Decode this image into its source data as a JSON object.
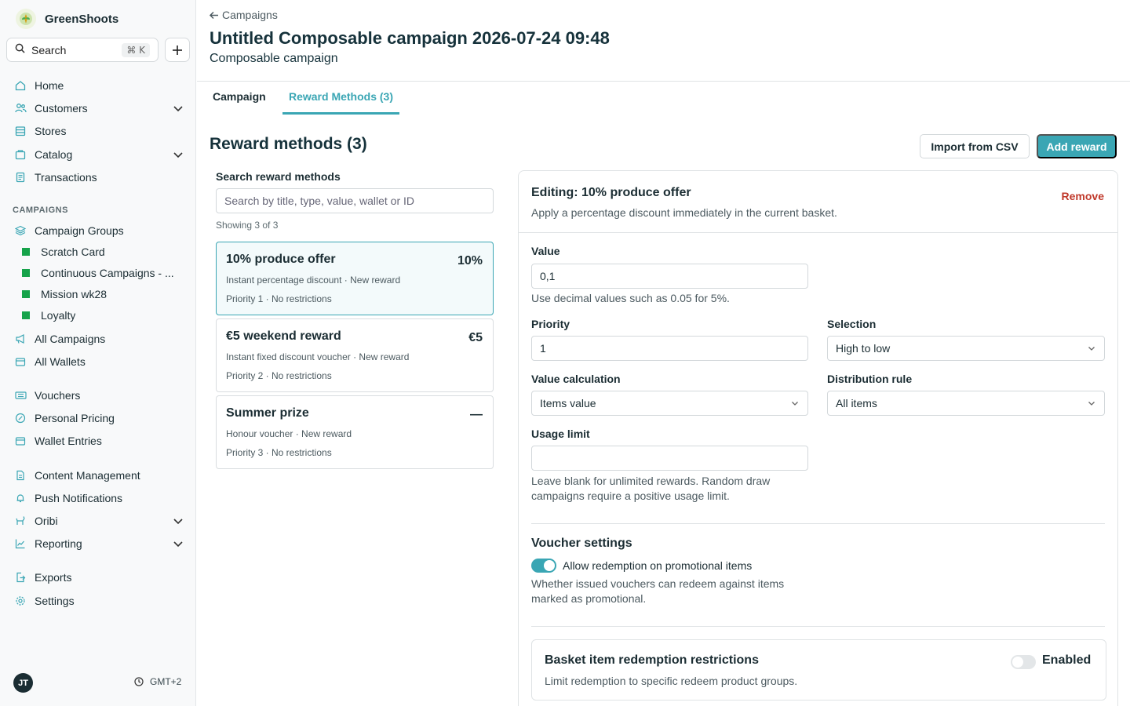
{
  "brand": {
    "name": "GreenShoots"
  },
  "sidebar": {
    "search_label": "Search",
    "search_shortcut": "⌘ K",
    "nav_main": [
      {
        "label": "Home",
        "icon": "home-icon"
      },
      {
        "label": "Customers",
        "icon": "users-icon",
        "expandable": true
      },
      {
        "label": "Stores",
        "icon": "store-icon"
      },
      {
        "label": "Catalog",
        "icon": "catalog-icon",
        "expandable": true
      },
      {
        "label": "Transactions",
        "icon": "receipt-icon"
      }
    ],
    "campaigns_heading": "CAMPAIGNS",
    "campaign_groups_label": "Campaign Groups",
    "campaign_groups": [
      {
        "label": "Scratch Card",
        "color": "#16a34a"
      },
      {
        "label": "Continuous Campaigns - ...",
        "color": "#16a34a"
      },
      {
        "label": "Mission wk28",
        "color": "#16a34a"
      },
      {
        "label": "Loyalty",
        "color": "#16a34a"
      }
    ],
    "all_campaigns": "All Campaigns",
    "all_wallets": "All Wallets",
    "vouchers": "Vouchers",
    "personal_pricing": "Personal Pricing",
    "wallet_entries": "Wallet Entries",
    "content_management": "Content Management",
    "push_notifications": "Push Notifications",
    "oribi": "Oribi",
    "reporting": "Reporting",
    "exports": "Exports",
    "settings": "Settings",
    "avatar_initials": "JT",
    "timezone": "GMT+2"
  },
  "header": {
    "back_label": "Campaigns",
    "title": "Untitled Composable campaign 2026-07-24 09:48",
    "subtitle": "Composable campaign",
    "tabs": [
      {
        "label": "Campaign",
        "active": false
      },
      {
        "label": "Reward Methods (3)",
        "active": true
      }
    ]
  },
  "rewards": {
    "heading": "Reward methods (3)",
    "import_label": "Import from CSV",
    "add_label": "Add reward",
    "search_label": "Search reward methods",
    "search_placeholder": "Search by title, type, value, wallet or ID",
    "showing": "Showing 3 of 3",
    "items": [
      {
        "title": "10% produce offer",
        "value": "10%",
        "desc": "Instant percentage discount · New reward",
        "meta": "Priority 1  ·  No restrictions",
        "selected": true
      },
      {
        "title": "€5 weekend reward",
        "value": "€5",
        "desc": "Instant fixed discount voucher · New reward",
        "meta": "Priority 2  ·  No restrictions",
        "selected": false
      },
      {
        "title": "Summer prize",
        "value": "—",
        "desc": "Honour voucher · New reward",
        "meta": "Priority 3  ·  No restrictions",
        "selected": false
      }
    ]
  },
  "editor": {
    "title": "Editing: 10% produce offer",
    "description": "Apply a percentage discount immediately in the current basket.",
    "remove_label": "Remove",
    "value_label": "Value",
    "value": "0,1",
    "value_help": "Use decimal values such as 0.05 for 5%.",
    "priority_label": "Priority",
    "priority": "1",
    "selection_label": "Selection",
    "selection": "High to low",
    "value_calc_label": "Value calculation",
    "value_calc": "Items value",
    "distribution_label": "Distribution rule",
    "distribution": "All items",
    "usage_label": "Usage limit",
    "usage_value": "",
    "usage_help_1": "Leave blank for unlimited rewards. Random draw",
    "usage_help_2": "campaigns require a positive usage limit.",
    "voucher_heading": "Voucher settings",
    "promo_toggle_label": "Allow redemption on promotional items",
    "promo_toggle_on": true,
    "promo_help_1": "Whether issued vouchers can redeem against items",
    "promo_help_2": "marked as promotional.",
    "basket_title": "Basket item redemption restrictions",
    "basket_desc": "Limit redemption to specific redeem product groups.",
    "basket_toggle_label": "Enabled",
    "basket_toggle_on": false
  },
  "colors": {
    "accent": "#3aa6b4",
    "danger": "#c0392b",
    "group": "#16a34a"
  }
}
